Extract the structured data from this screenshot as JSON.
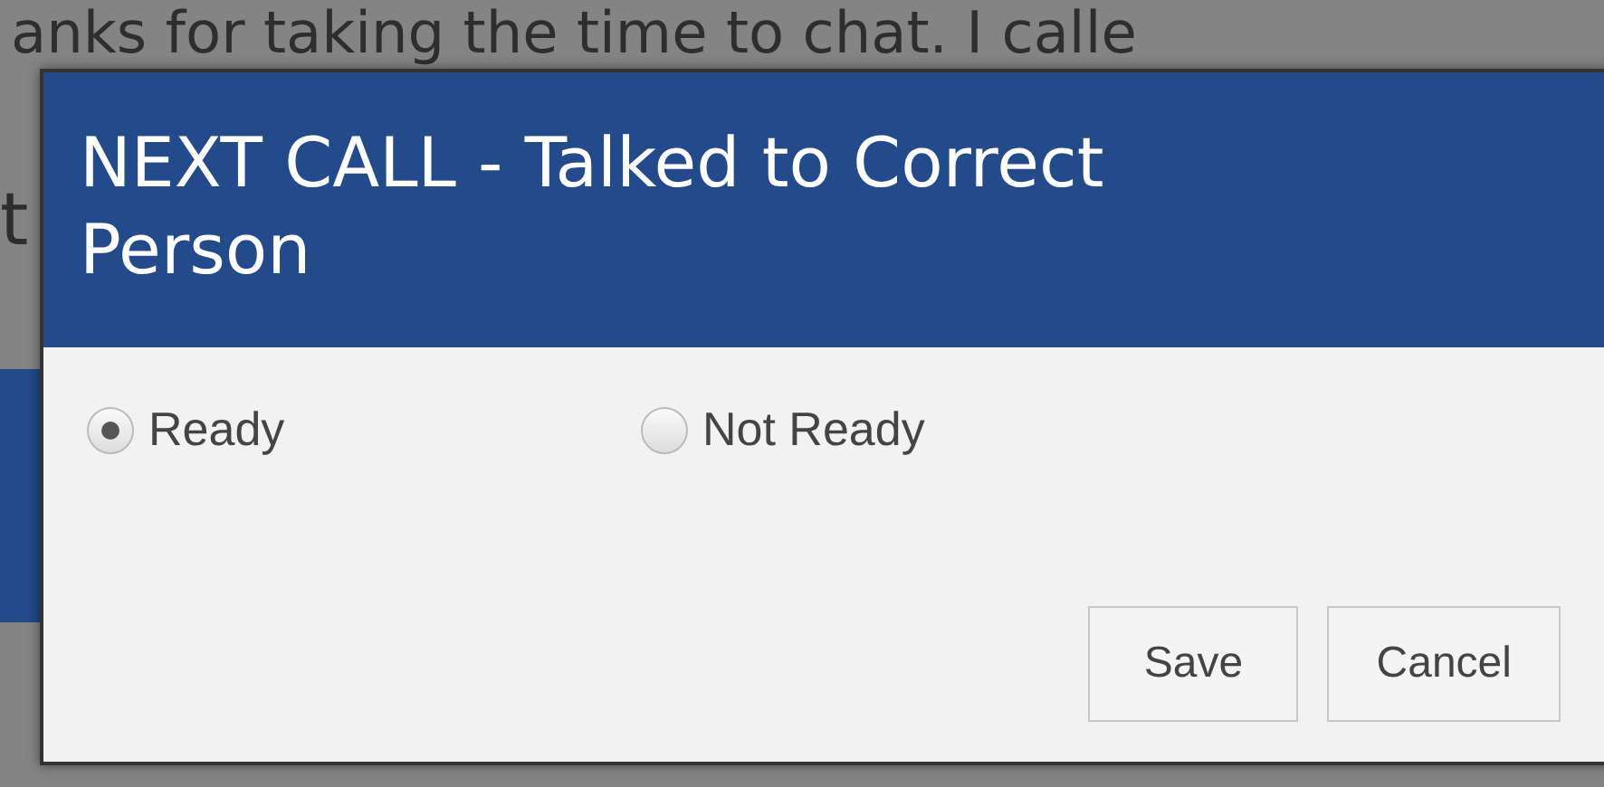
{
  "background": {
    "lines": [
      "anks for taking the time to chat. I calle",
      "t"
    ]
  },
  "dialog": {
    "title": "NEXT CALL - Talked to Correct Person",
    "options": [
      {
        "label": "Ready",
        "selected": true
      },
      {
        "label": "Not Ready",
        "selected": false
      }
    ],
    "buttons": [
      "Save",
      "Cancel"
    ]
  }
}
